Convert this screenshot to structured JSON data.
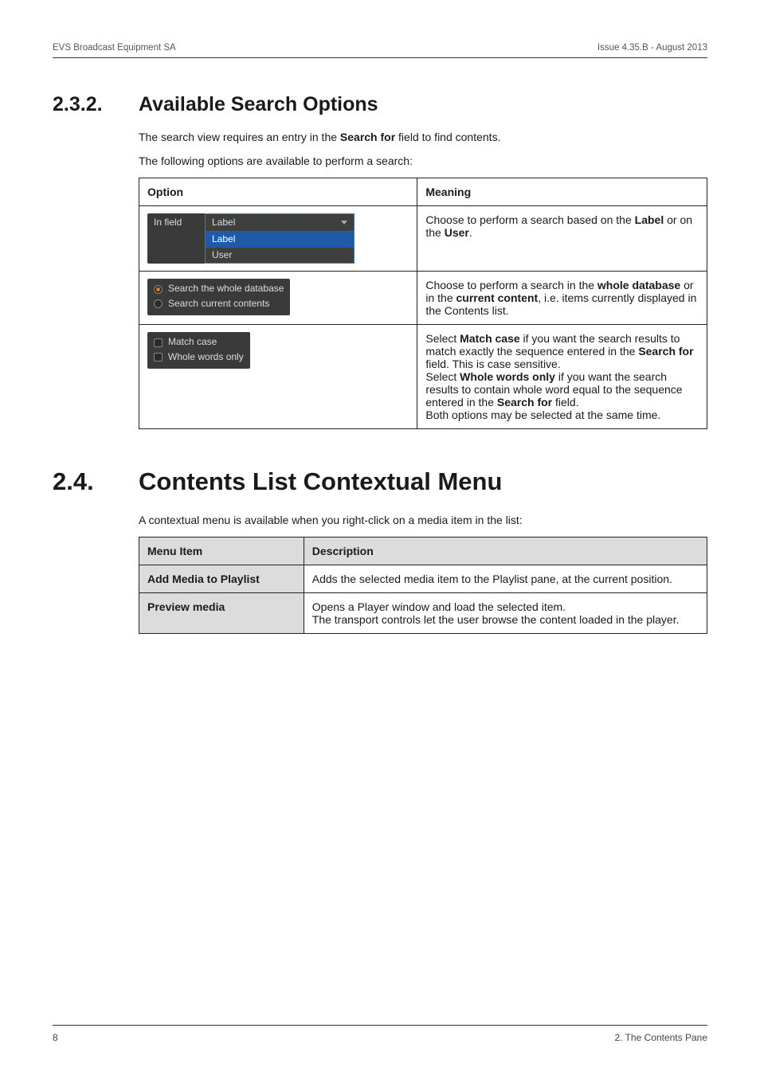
{
  "runhead": {
    "left": "EVS Broadcast Equipment SA",
    "right": "Issue 4.35.B - August 2013"
  },
  "sec232": {
    "num": "2.3.2.",
    "title": "Available Search Options",
    "intro1_a": "The search view requires an entry in the ",
    "intro1_b": "Search for",
    "intro1_c": " field to find contents.",
    "intro2": "The following options are available to perform a search:",
    "th_option": "Option",
    "th_meaning": "Meaning",
    "row1": {
      "ui_label": "In field",
      "ui_sel": "Label",
      "ui_opt1": "Label",
      "ui_opt2": "User",
      "m1": "Choose to perform a search based on the ",
      "m2": "Label",
      "m3": " or on the ",
      "m4": "User",
      "m5": "."
    },
    "row2": {
      "ui_r1": "Search the whole database",
      "ui_r2": "Search current contents",
      "m1": "Choose to perform a search in the ",
      "m2": "whole database",
      "m3": " or in the ",
      "m4": "current content",
      "m5": ", i.e. items currently displayed in the Contents list."
    },
    "row3": {
      "ui_c1": "Match case",
      "ui_c2": "Whole words only",
      "m1": "Select ",
      "m2": "Match case",
      "m3": " if you want the search results to match exactly the sequence entered in the ",
      "m4": "Search for",
      "m5": " field. This is case sensitive.",
      "m6": "Select ",
      "m7": "Whole words only",
      "m8": " if you want the search results to contain whole word equal to the sequence entered in the ",
      "m9": "Search for",
      "m10": " field.",
      "m11": "Both options may be selected at the same time."
    }
  },
  "sec24": {
    "num": "2.4.",
    "title": "Contents List Contextual Menu",
    "intro": "A contextual menu is available when you right-click on a media item in the list:",
    "th_item": "Menu Item",
    "th_desc": "Description",
    "r1_item": "Add Media to Playlist",
    "r1_desc": "Adds the selected media item to the Playlist pane, at the current position.",
    "r2_item": "Preview media",
    "r2_desc": "Opens a Player window and load the selected item.\nThe transport controls let the user browse the content loaded in the player."
  },
  "footer": {
    "left": "8",
    "right": "2. The Contents Pane"
  }
}
